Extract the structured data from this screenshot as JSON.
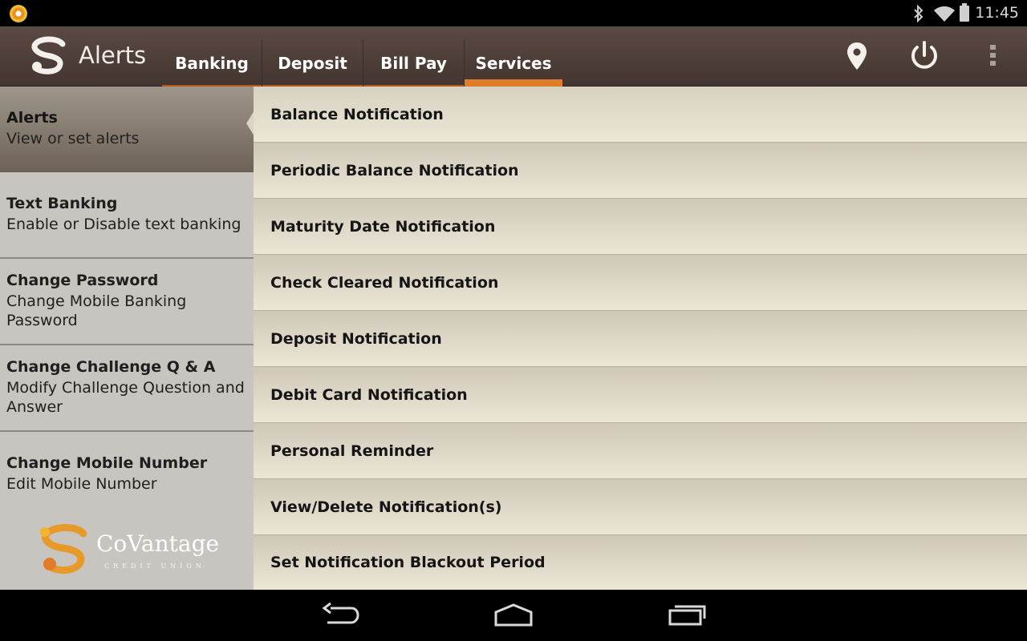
{
  "status_bar": {
    "time": "11:45",
    "icons": [
      "app-notification-icon",
      "bluetooth-icon",
      "wifi-icon",
      "battery-icon"
    ]
  },
  "action_bar": {
    "title": "Alerts",
    "tabs": [
      {
        "label": "Banking",
        "active": false
      },
      {
        "label": "Deposit",
        "active": false
      },
      {
        "label": "Bill Pay",
        "active": false
      },
      {
        "label": "Services",
        "active": true
      }
    ],
    "actions": [
      "location-icon",
      "power-icon",
      "overflow-menu-icon"
    ],
    "colors": {
      "accent": "#e07d2a",
      "bar": "#4e3f39"
    }
  },
  "sidebar": {
    "items": [
      {
        "title": "Alerts",
        "subtitle": "View or set alerts",
        "selected": true
      },
      {
        "title": "Text Banking",
        "subtitle": "Enable or Disable text banking",
        "selected": false
      },
      {
        "title": "Change Password",
        "subtitle": "Change Mobile Banking Password",
        "selected": false
      },
      {
        "title": "Change Challenge Q & A",
        "subtitle": "Modify Challenge Question and Answer",
        "selected": false
      },
      {
        "title": "Change Mobile Number",
        "subtitle": "Edit Mobile Number",
        "selected": false
      }
    ],
    "logo": {
      "name": "CoVantage",
      "tagline": "CREDIT UNION"
    }
  },
  "notifications": {
    "items": [
      "Balance Notification",
      "Periodic Balance Notification",
      "Maturity Date Notification",
      "Check Cleared Notification",
      "Deposit Notification",
      "Debit Card Notification",
      "Personal Reminder",
      "View/Delete Notification(s)",
      "Set Notification Blackout Period"
    ]
  },
  "nav_bar": {
    "buttons": [
      "back-icon",
      "home-icon",
      "recents-icon"
    ]
  }
}
